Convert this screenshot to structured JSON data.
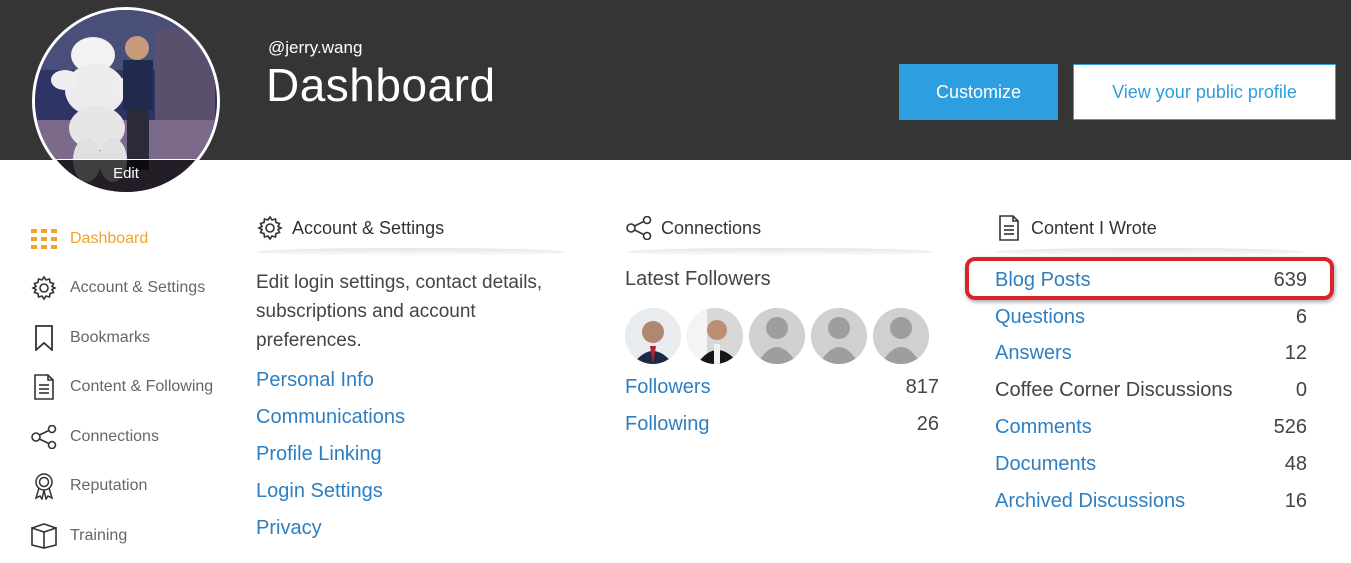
{
  "header": {
    "handle": "@jerry.wang",
    "title": "Dashboard",
    "avatar_edit_label": "Edit",
    "customize_label": "Customize",
    "public_profile_label": "View your public profile"
  },
  "sidebar": {
    "items": [
      {
        "label": "Dashboard",
        "icon": "grid-icon",
        "active": true
      },
      {
        "label": "Account & Settings",
        "icon": "gear-icon"
      },
      {
        "label": "Bookmarks",
        "icon": "bookmark-icon"
      },
      {
        "label": "Content & Following",
        "icon": "document-icon"
      },
      {
        "label": "Connections",
        "icon": "share-icon"
      },
      {
        "label": "Reputation",
        "icon": "award-icon"
      },
      {
        "label": "Training",
        "icon": "book-icon"
      }
    ]
  },
  "account": {
    "heading": "Account & Settings",
    "description": "Edit login settings, contact details, subscriptions and account preferences.",
    "links": [
      "Personal Info",
      "Communications",
      "Profile Linking",
      "Login Settings",
      "Privacy"
    ]
  },
  "connections": {
    "heading": "Connections",
    "latest_followers_label": "Latest Followers",
    "rows": [
      {
        "label": "Followers",
        "count": "817"
      },
      {
        "label": "Following",
        "count": "26"
      }
    ]
  },
  "content": {
    "heading": "Content I Wrote",
    "rows": [
      {
        "label": "Blog Posts",
        "count": "639",
        "link": true
      },
      {
        "label": "Questions",
        "count": "6",
        "link": true
      },
      {
        "label": "Answers",
        "count": "12",
        "link": true
      },
      {
        "label": "Coffee Corner Discussions",
        "count": "0",
        "link": false
      },
      {
        "label": "Comments",
        "count": "526",
        "link": true
      },
      {
        "label": "Documents",
        "count": "48",
        "link": true
      },
      {
        "label": "Archived Discussions",
        "count": "16",
        "link": true
      }
    ]
  },
  "colors": {
    "header_bg": "#353535",
    "accent": "#2d9ee0",
    "link": "#2d7fc1",
    "active_nav": "#f0a32b",
    "highlight": "#d9242b"
  }
}
